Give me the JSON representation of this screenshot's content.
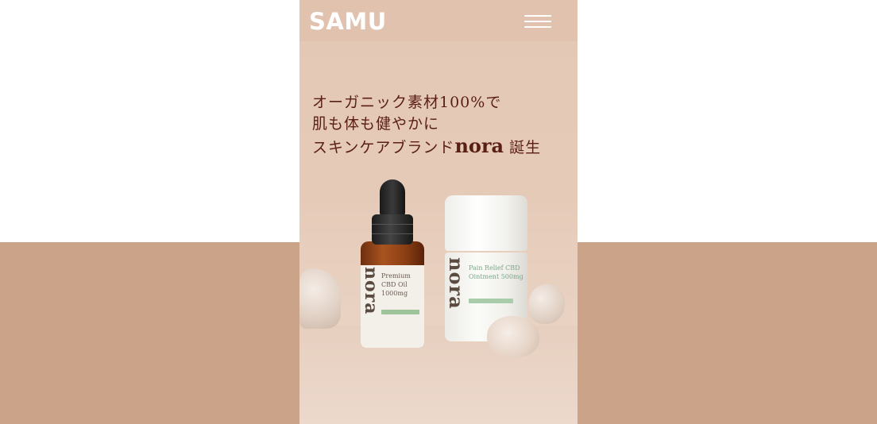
{
  "header": {
    "logo": "SAMU",
    "menu_icon": "hamburger-menu-icon"
  },
  "hero": {
    "headline_line1": "オーガニック素材100%で",
    "headline_line2": "肌も体も健やかに",
    "headline_line3_prefix": "スキンケアブランド",
    "headline_line3_brand": "nora",
    "headline_line3_suffix": "誕生",
    "products": {
      "oil": {
        "brand": "nora",
        "name": "Premium CBD Oil 1000mg"
      },
      "ointment": {
        "brand": "nora",
        "name": "Pain Relief CBD Ointment 500mg"
      }
    }
  },
  "colors": {
    "side_band": "#cba388",
    "headline_text": "#5a1f14",
    "header_text": "#ffffff",
    "background": "#e6cab8"
  }
}
